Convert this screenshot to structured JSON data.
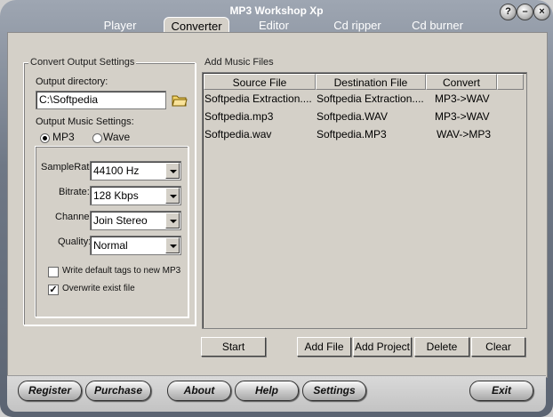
{
  "window": {
    "title": "MP3 Workshop Xp",
    "help_glyph": "?",
    "minimize_glyph": "–",
    "close_glyph": "×"
  },
  "tabs": [
    "Player",
    "Converter",
    "Editor",
    "Cd ripper",
    "Cd burner"
  ],
  "active_tab": "Converter",
  "left_panel": {
    "group_title": "Convert Output Settings",
    "output_dir_label": "Output directory:",
    "output_dir_value": "C:\\Softpedia",
    "music_settings_label": "Output Music Settings:",
    "format_options": [
      "MP3",
      "Wave"
    ],
    "selected_format": "MP3",
    "samplerate_label": "SampleRate:",
    "samplerate_value": "44100 Hz",
    "bitrate_label": "Bitrate:",
    "bitrate_value": "128 Kbps",
    "channel_label": "Channel:",
    "channel_value": "Join Stereo",
    "quality_label": "Quality:",
    "quality_value": "Normal",
    "write_tags_label": "Write default tags to new MP3",
    "write_tags_checked": false,
    "overwrite_label": "Overwrite exist file",
    "overwrite_checked": true
  },
  "right_panel": {
    "group_title": "Add Music Files",
    "columns": [
      "Source File",
      "Destination File",
      "Convert"
    ],
    "rows": [
      {
        "source": "Softpedia Extraction....",
        "dest": "Softpedia Extraction....",
        "convert": "MP3->WAV"
      },
      {
        "source": "Softpedia.mp3",
        "dest": "Softpedia.WAV",
        "convert": "MP3->WAV"
      },
      {
        "source": "Softpedia.wav",
        "dest": "Softpedia.MP3",
        "convert": "WAV->MP3"
      }
    ],
    "buttons": {
      "start": "Start",
      "add_file": "Add File",
      "add_project": "Add Project",
      "delete": "Delete",
      "clear": "Clear"
    }
  },
  "bottom_bar": {
    "register": "Register",
    "purchase": "Purchase",
    "about": "About",
    "help": "Help",
    "settings": "Settings",
    "exit": "Exit"
  },
  "colors": {
    "face": "#d4d0c8",
    "frame": "#6f7886",
    "highlight_selected": "#000000"
  }
}
